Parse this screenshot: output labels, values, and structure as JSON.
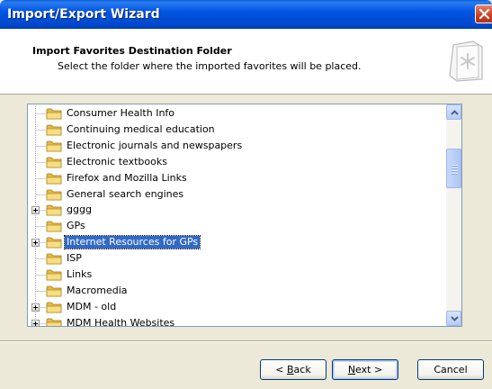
{
  "window": {
    "title": "Import/Export Wizard",
    "close_icon": "close-icon"
  },
  "header": {
    "title": "Import Favorites Destination Folder",
    "subtitle": "Select the folder where the imported favorites will be placed.",
    "icon": "favorites-wizard-icon"
  },
  "tree": {
    "items": [
      {
        "label": "Consumer Health Info",
        "expandable": false,
        "selected": false
      },
      {
        "label": "Continuing medical education",
        "expandable": false,
        "selected": false
      },
      {
        "label": "Electronic journals and newspapers",
        "expandable": false,
        "selected": false
      },
      {
        "label": "Electronic textbooks",
        "expandable": false,
        "selected": false
      },
      {
        "label": "Firefox and Mozilla Links",
        "expandable": false,
        "selected": false
      },
      {
        "label": "General search engines",
        "expandable": false,
        "selected": false
      },
      {
        "label": "gggg",
        "expandable": true,
        "selected": false
      },
      {
        "label": "GPs",
        "expandable": false,
        "selected": false
      },
      {
        "label": "Internet Resources for GPs",
        "expandable": true,
        "selected": true
      },
      {
        "label": "ISP",
        "expandable": false,
        "selected": false
      },
      {
        "label": "Links",
        "expandable": false,
        "selected": false
      },
      {
        "label": "Macromedia",
        "expandable": false,
        "selected": false
      },
      {
        "label": "MDM - old",
        "expandable": true,
        "selected": false
      },
      {
        "label": "MDM Health Websites",
        "expandable": true,
        "selected": false
      }
    ]
  },
  "buttons": {
    "back_prefix": "< ",
    "back_mnemonic": "B",
    "back_rest": "ack",
    "next_mnemonic": "N",
    "next_rest": "ext >",
    "cancel": "Cancel"
  },
  "colors": {
    "title_bar": "#0055e3",
    "selection": "#316ac5",
    "folder": "#f5d77b"
  }
}
